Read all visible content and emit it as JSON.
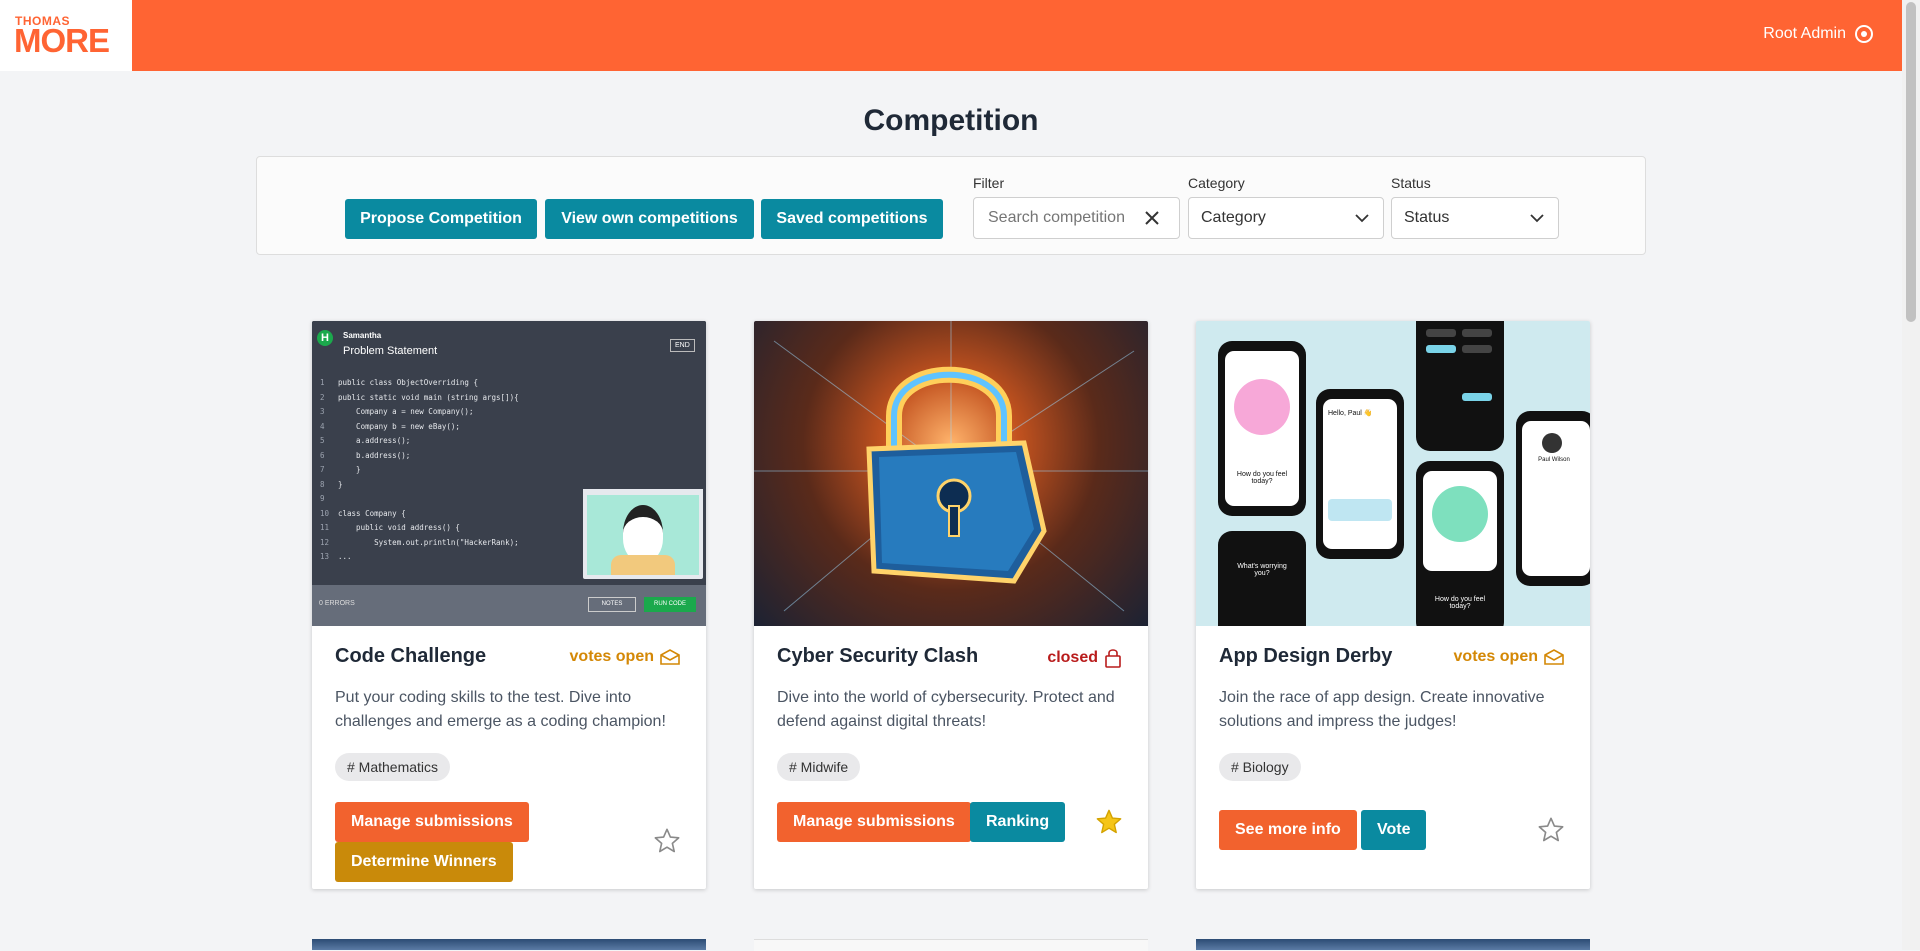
{
  "header": {
    "logo_top": "THOMAS",
    "logo_bottom": "MORE",
    "user_name": "Root Admin",
    "user_icon": "power-icon"
  },
  "page": {
    "title": "Competition"
  },
  "toolbar": {
    "propose": "Propose Competition",
    "view_own": "View own competitions",
    "saved": "Saved competitions"
  },
  "filters": {
    "filter_label": "Filter",
    "search_placeholder": "Search competition",
    "category_label": "Category",
    "category_value": "Category",
    "status_label": "Status",
    "status_value": "Status"
  },
  "colors": {
    "brand": "#ff6433",
    "teal": "#0a8aa0",
    "orange_button": "#f2622e",
    "gold_button": "#c98a0a",
    "votes_open": "#d48806",
    "closed": "#b91c1c",
    "star_active": "#f5c518"
  },
  "cards": [
    {
      "title": "Code Challenge",
      "status": "votes open",
      "status_icon": "envelope-open-icon",
      "description": "Put your coding skills to the test. Dive into challenges and emerge as a coding champion!",
      "tag": "# Mathematics",
      "buttons": [
        "Manage submissions",
        "Determine Winners"
      ],
      "starred": false,
      "image": {
        "user": "Samantha",
        "heading": "Problem Statement",
        "end_button": "END",
        "code_lines": [
          "public class ObjectOverriding {",
          "public static void main (string args[]){",
          "    Company a = new Company();",
          "    Company b = new eBay();",
          "    a.address();",
          "    b.address();",
          "    }",
          "}",
          "",
          "class Company {",
          "    public void address() {",
          "        System.out.println(\"HackerRank);",
          "..."
        ],
        "errors": "0 ERRORS",
        "notes": "NOTES",
        "run": "RUN CODE"
      }
    },
    {
      "title": "Cyber Security Clash",
      "status": "closed",
      "status_icon": "lock-icon",
      "description": "Dive into the world of cybersecurity. Protect and defend against digital threats!",
      "tag": "# Midwife",
      "buttons": [
        "Manage submissions",
        "Ranking"
      ],
      "starred": true
    },
    {
      "title": "App Design Derby",
      "status": "votes open",
      "status_icon": "envelope-open-icon",
      "description": "Join the race of app design. Create innovative solutions and impress the judges!",
      "tag": "# Biology",
      "buttons": [
        "See more info",
        "Vote"
      ],
      "starred": false,
      "image": {
        "greeting": "Hello, Paul 👋",
        "question1": "How do you feel today?",
        "question2": "What's worrying you?",
        "profile": "Paul Wilson"
      }
    }
  ]
}
